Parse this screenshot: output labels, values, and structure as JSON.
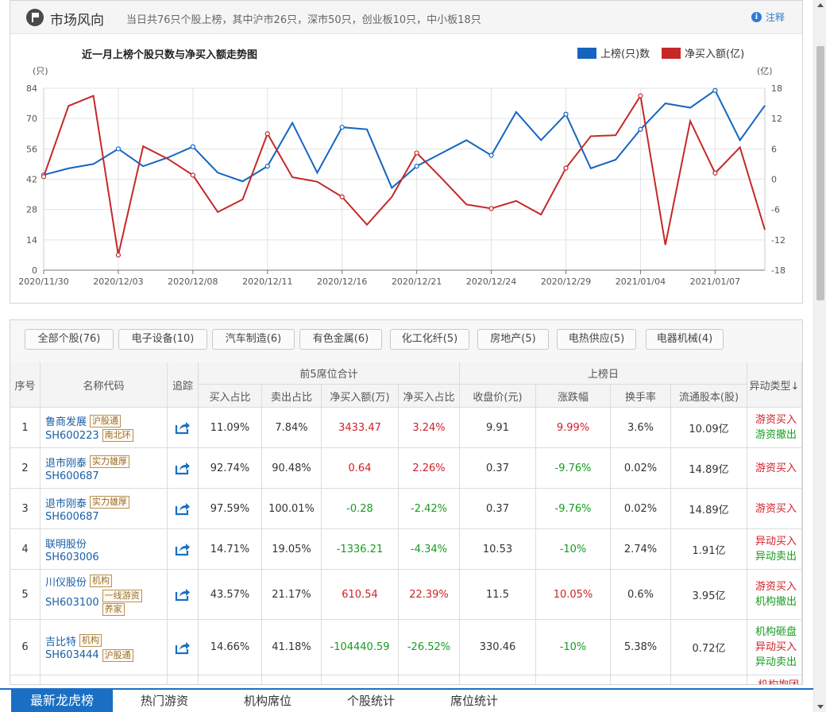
{
  "header": {
    "title": "市场风向",
    "summary": "当日共76只个股上榜，其中沪市26只，深市50只，创业板10只，中小板18只",
    "note": "注释"
  },
  "chart_data": {
    "type": "line",
    "title": "近一月上榜个股只数与净买入额走势图",
    "left_unit": "(只)",
    "right_unit": "(亿)",
    "legend": [
      "上榜(只)数",
      "净买入额(亿)"
    ],
    "colors": {
      "count": "#1565c0",
      "netbuy": "#c62828"
    },
    "left_ticks": [
      "84",
      "70",
      "56",
      "42",
      "28",
      "14",
      "0"
    ],
    "right_ticks": [
      "18",
      "12",
      "6",
      "0",
      "-6",
      "-12",
      "-18"
    ],
    "ylim_left": [
      0,
      84
    ],
    "ylim_right": [
      -18,
      18
    ],
    "x_labels": [
      "2020/11/30",
      "2020/12/03",
      "2020/12/08",
      "2020/12/11",
      "2020/12/16",
      "2020/12/21",
      "2020/12/24",
      "2020/12/29",
      "2021/01/04",
      "2021/01/07"
    ],
    "series": [
      {
        "name": "上榜(只)数",
        "axis": "left",
        "values": [
          44,
          47,
          49,
          56,
          48,
          52,
          57,
          45,
          41,
          48,
          68,
          45,
          66,
          65,
          38,
          48,
          54,
          60,
          53,
          73,
          60,
          72,
          47,
          51,
          65,
          77,
          75,
          83,
          60,
          76
        ]
      },
      {
        "name": "净买入额(亿)",
        "axis": "right",
        "values": [
          0.5,
          14.5,
          16.5,
          -15,
          6.5,
          4,
          0.8,
          -6.5,
          -4,
          9,
          0.4,
          -0.5,
          -3.5,
          -9,
          -3.5,
          5.2,
          0.2,
          -5,
          -5.8,
          -4.3,
          -7,
          2.2,
          8.5,
          8.7,
          16.5,
          -13,
          11.5,
          1.2,
          6.3,
          -10
        ]
      }
    ],
    "marked_points": [
      0,
      3,
      6,
      9,
      12,
      15,
      18,
      21,
      24,
      27
    ]
  },
  "filters": [
    "全部个股(76)",
    "电子设备(10)",
    "汽车制造(6)",
    "有色金属(6)",
    "化工化纤(5)",
    "房地产(5)",
    "电热供应(5)",
    "电器机械(4)"
  ],
  "table": {
    "headers": {
      "seq": "序号",
      "name": "名称代码",
      "track": "追踪",
      "group1": "前5席位合计",
      "group2": "上榜日",
      "type": "异动类型↓"
    },
    "subheaders": [
      "买入占比",
      "卖出占比",
      "净买入额(万)",
      "净买入占比",
      "收盘价(元)",
      "涨跌幅",
      "换手率",
      "流通股本(股)"
    ],
    "rows": [
      {
        "seq": "1",
        "name": "鲁商发展",
        "code": "SH600223",
        "tags": [
          "沪股通",
          "南北环"
        ],
        "buy": "11.09%",
        "sell": "7.84%",
        "net": "3433.47",
        "netpct": "3.24%",
        "close": "9.91",
        "chg": "9.99%",
        "turn": "3.6%",
        "cap": "10.09亿",
        "types": [
          "游资买入",
          "游资撤出"
        ]
      },
      {
        "seq": "2",
        "name": "退市刚泰",
        "code": "SH600687",
        "tags": [
          "实力雄厚"
        ],
        "buy": "92.74%",
        "sell": "90.48%",
        "net": "0.64",
        "netpct": "2.26%",
        "close": "0.37",
        "chg": "-9.76%",
        "turn": "0.02%",
        "cap": "14.89亿",
        "types": [
          "游资买入"
        ]
      },
      {
        "seq": "3",
        "name": "退市刚泰",
        "code": "SH600687",
        "tags": [
          "实力雄厚"
        ],
        "buy": "97.59%",
        "sell": "100.01%",
        "net": "-0.28",
        "netpct": "-2.42%",
        "close": "0.37",
        "chg": "-9.76%",
        "turn": "0.02%",
        "cap": "14.89亿",
        "types": [
          "游资买入"
        ]
      },
      {
        "seq": "4",
        "name": "联明股份",
        "code": "SH603006",
        "tags": [],
        "buy": "14.71%",
        "sell": "19.05%",
        "net": "-1336.21",
        "netpct": "-4.34%",
        "close": "10.53",
        "chg": "-10%",
        "turn": "2.74%",
        "cap": "1.91亿",
        "types": [
          "异动买入",
          "异动卖出"
        ]
      },
      {
        "seq": "5",
        "name": "川仪股份",
        "code": "SH603100",
        "tags": [
          "机构",
          "一线游资",
          "养家"
        ],
        "buy": "43.57%",
        "sell": "21.17%",
        "net": "610.54",
        "netpct": "22.39%",
        "close": "11.5",
        "chg": "10.05%",
        "turn": "0.6%",
        "cap": "3.95亿",
        "types": [
          "游资买入",
          "机构撤出"
        ]
      },
      {
        "seq": "6",
        "name": "吉比特",
        "code": "SH603444",
        "tags": [
          "机构",
          "沪股通"
        ],
        "buy": "14.66%",
        "sell": "41.18%",
        "net": "-104440.59",
        "netpct": "-26.52%",
        "close": "330.46",
        "chg": "-10%",
        "turn": "5.38%",
        "cap": "0.72亿",
        "types": [
          "机构砸盘",
          "异动买入",
          "异动卖出"
        ]
      }
    ],
    "partial_row_type": "机构抱团买入"
  },
  "bottom_tabs": [
    "最新龙虎榜",
    "热门游资",
    "机构席位",
    "个股统计",
    "席位统计"
  ]
}
